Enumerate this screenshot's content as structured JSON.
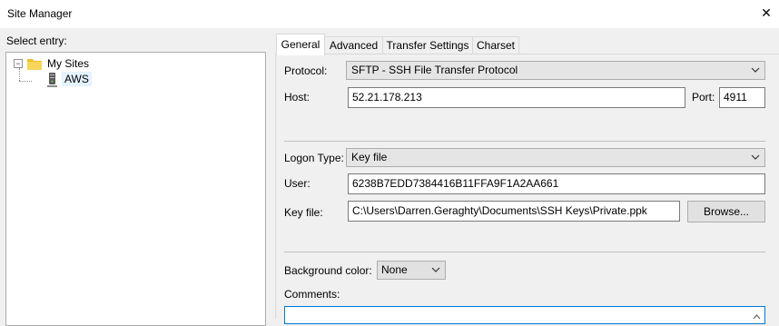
{
  "window": {
    "title": "Site Manager",
    "close_glyph": "✕"
  },
  "tree": {
    "label": "Select entry:",
    "expander": "−",
    "root": {
      "label": "My Sites",
      "icon": "folder-icon"
    },
    "children": [
      {
        "label": "AWS",
        "icon": "server-icon"
      }
    ]
  },
  "tabs": [
    {
      "label": "General"
    },
    {
      "label": "Advanced"
    },
    {
      "label": "Transfer Settings"
    },
    {
      "label": "Charset"
    }
  ],
  "general": {
    "protocol": {
      "label": "Protocol:",
      "value": "SFTP - SSH File Transfer Protocol"
    },
    "host": {
      "label": "Host:",
      "value": "52.21.178.213"
    },
    "port": {
      "label": "Port:",
      "value": "4911"
    },
    "logon_type": {
      "label": "Logon Type:",
      "value": "Key file"
    },
    "user": {
      "label": "User:",
      "value": "6238B7EDD7384416B11FFA9F1A2AA661"
    },
    "key_file": {
      "label": "Key file:",
      "value": "C:\\Users\\Darren.Geraghty\\Documents\\SSH Keys\\Private.ppk",
      "browse_label": "Browse..."
    },
    "background_color": {
      "label": "Background color:",
      "value": "None"
    },
    "comments": {
      "label": "Comments:",
      "value": ""
    }
  },
  "colors": {
    "folder": "#f2c029",
    "selection": "#e5f3ff",
    "focus": "#0078d7"
  }
}
